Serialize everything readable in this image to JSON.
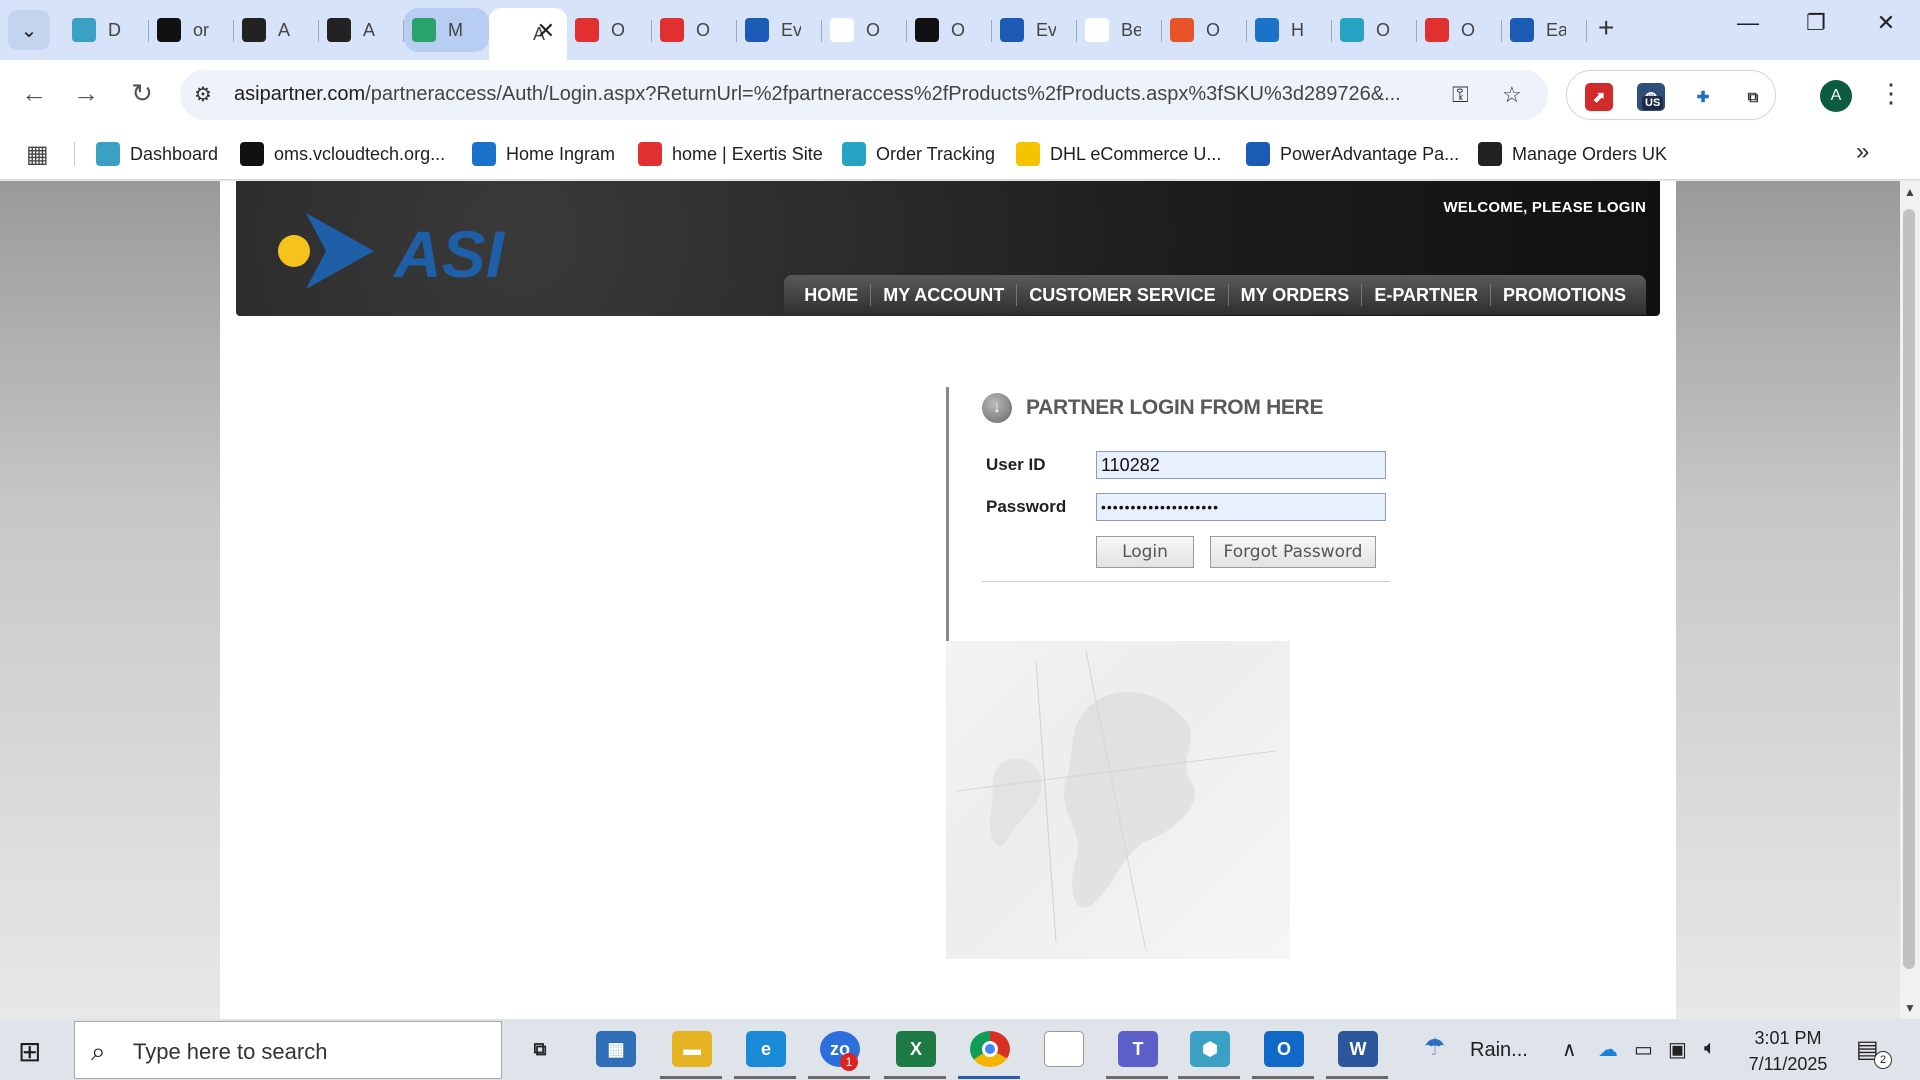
{
  "browser": {
    "tabs": [
      {
        "title": "D",
        "icon": "hexagon-icon",
        "color": "#3aa0c4"
      },
      {
        "title": "or",
        "icon": "triangle-logo-icon",
        "color": "#111111"
      },
      {
        "title": "A",
        "icon": "amazon-icon",
        "color": "#222222"
      },
      {
        "title": "A",
        "icon": "amazon-icon",
        "color": "#222222"
      },
      {
        "title": "M",
        "icon": "green-circle-icon",
        "color": "#27a36b"
      },
      {
        "title": "A",
        "icon": "",
        "color": "#ffffff"
      },
      {
        "title": "O",
        "icon": "exertis-icon",
        "color": "#e03030"
      },
      {
        "title": "O",
        "icon": "exertis-icon",
        "color": "#e03030"
      },
      {
        "title": "Ev",
        "icon": "e-icon",
        "color": "#1b5bb5"
      },
      {
        "title": "O",
        "icon": "openai-icon",
        "color": "#ffffff"
      },
      {
        "title": "O",
        "icon": "openai-icon",
        "color": "#111111"
      },
      {
        "title": "Ev",
        "icon": "e-icon",
        "color": "#1b5bb5"
      },
      {
        "title": "Be",
        "icon": "bulb-icon",
        "color": "#ffffff"
      },
      {
        "title": "O",
        "icon": "stack-icon",
        "color": "#e8542a"
      },
      {
        "title": "H",
        "icon": "ingram-icon",
        "color": "#1a73c8"
      },
      {
        "title": "O",
        "icon": "c-circle-icon",
        "color": "#27a3c4"
      },
      {
        "title": "O",
        "icon": "eo-icon",
        "color": "#e03030"
      },
      {
        "title": "Ea",
        "icon": "etn-icon",
        "color": "#1b5bb5"
      }
    ],
    "url_host": "asipartner.com",
    "url_path": "/partneraccess/Auth/Login.aspx?ReturnUrl=%2fpartneraccess%2fProducts%2fProducts.aspx%3fSKU%3d289726&...",
    "ext_badge": "US",
    "profile_initial": "A",
    "bookmarks": [
      {
        "label": "Dashboard",
        "color": "#3aa0c4"
      },
      {
        "label": "oms.vcloudtech.org...",
        "color": "#111111"
      },
      {
        "label": "Home Ingram",
        "color": "#1a73c8"
      },
      {
        "label": "home | Exertis Site",
        "color": "#e03030"
      },
      {
        "label": "Order Tracking",
        "color": "#27a3c4"
      },
      {
        "label": "DHL eCommerce U...",
        "color": "#f5c400"
      },
      {
        "label": "PowerAdvantage Pa...",
        "color": "#1b5bb5"
      },
      {
        "label": "Manage Orders UK",
        "color": "#222222"
      }
    ]
  },
  "site": {
    "logo_text": "ASI",
    "brand_blue": "#1e5fa8",
    "brand_yellow": "#f6c21c",
    "welcome": "WELCOME, PLEASE LOGIN",
    "nav": [
      "HOME",
      "MY ACCOUNT",
      "CUSTOMER SERVICE",
      "MY ORDERS",
      "E-PARTNER",
      "PROMOTIONS"
    ],
    "login": {
      "title": "PARTNER LOGIN FROM HERE",
      "user_label": "User ID",
      "user_value": "110282",
      "password_label": "Password",
      "password_value": "••••••••••••••••••••",
      "login_button": "Login",
      "forgot_button": "Forgot Password"
    }
  },
  "taskbar": {
    "search_placeholder": "Type here to search",
    "weather": "Rain...",
    "time": "3:01 PM",
    "date": "7/11/2025",
    "notifications": "2",
    "zoom_badge": "1"
  }
}
